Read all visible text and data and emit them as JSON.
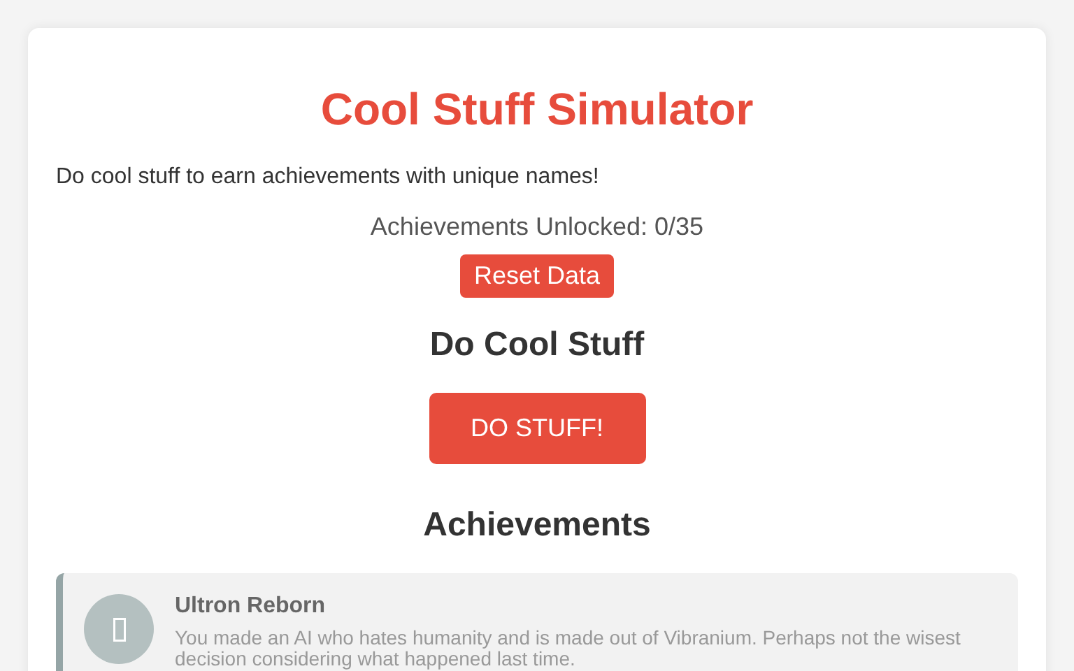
{
  "title": "Cool Stuff Simulator",
  "intro": "Do cool stuff to earn achievements with unique names!",
  "counter": "Achievements Unlocked: 0/35",
  "reset_button": "Reset Data",
  "action_heading": "Do Cool Stuff",
  "action_button": "DO STUFF!",
  "achievements_heading": "Achievements",
  "achievements": [
    {
      "name": "Ultron Reborn",
      "description": "You made an AI who hates humanity and is made out of Vibranium. Perhaps not the wisest decision considering what happened last time.",
      "unlocked": false
    }
  ]
}
